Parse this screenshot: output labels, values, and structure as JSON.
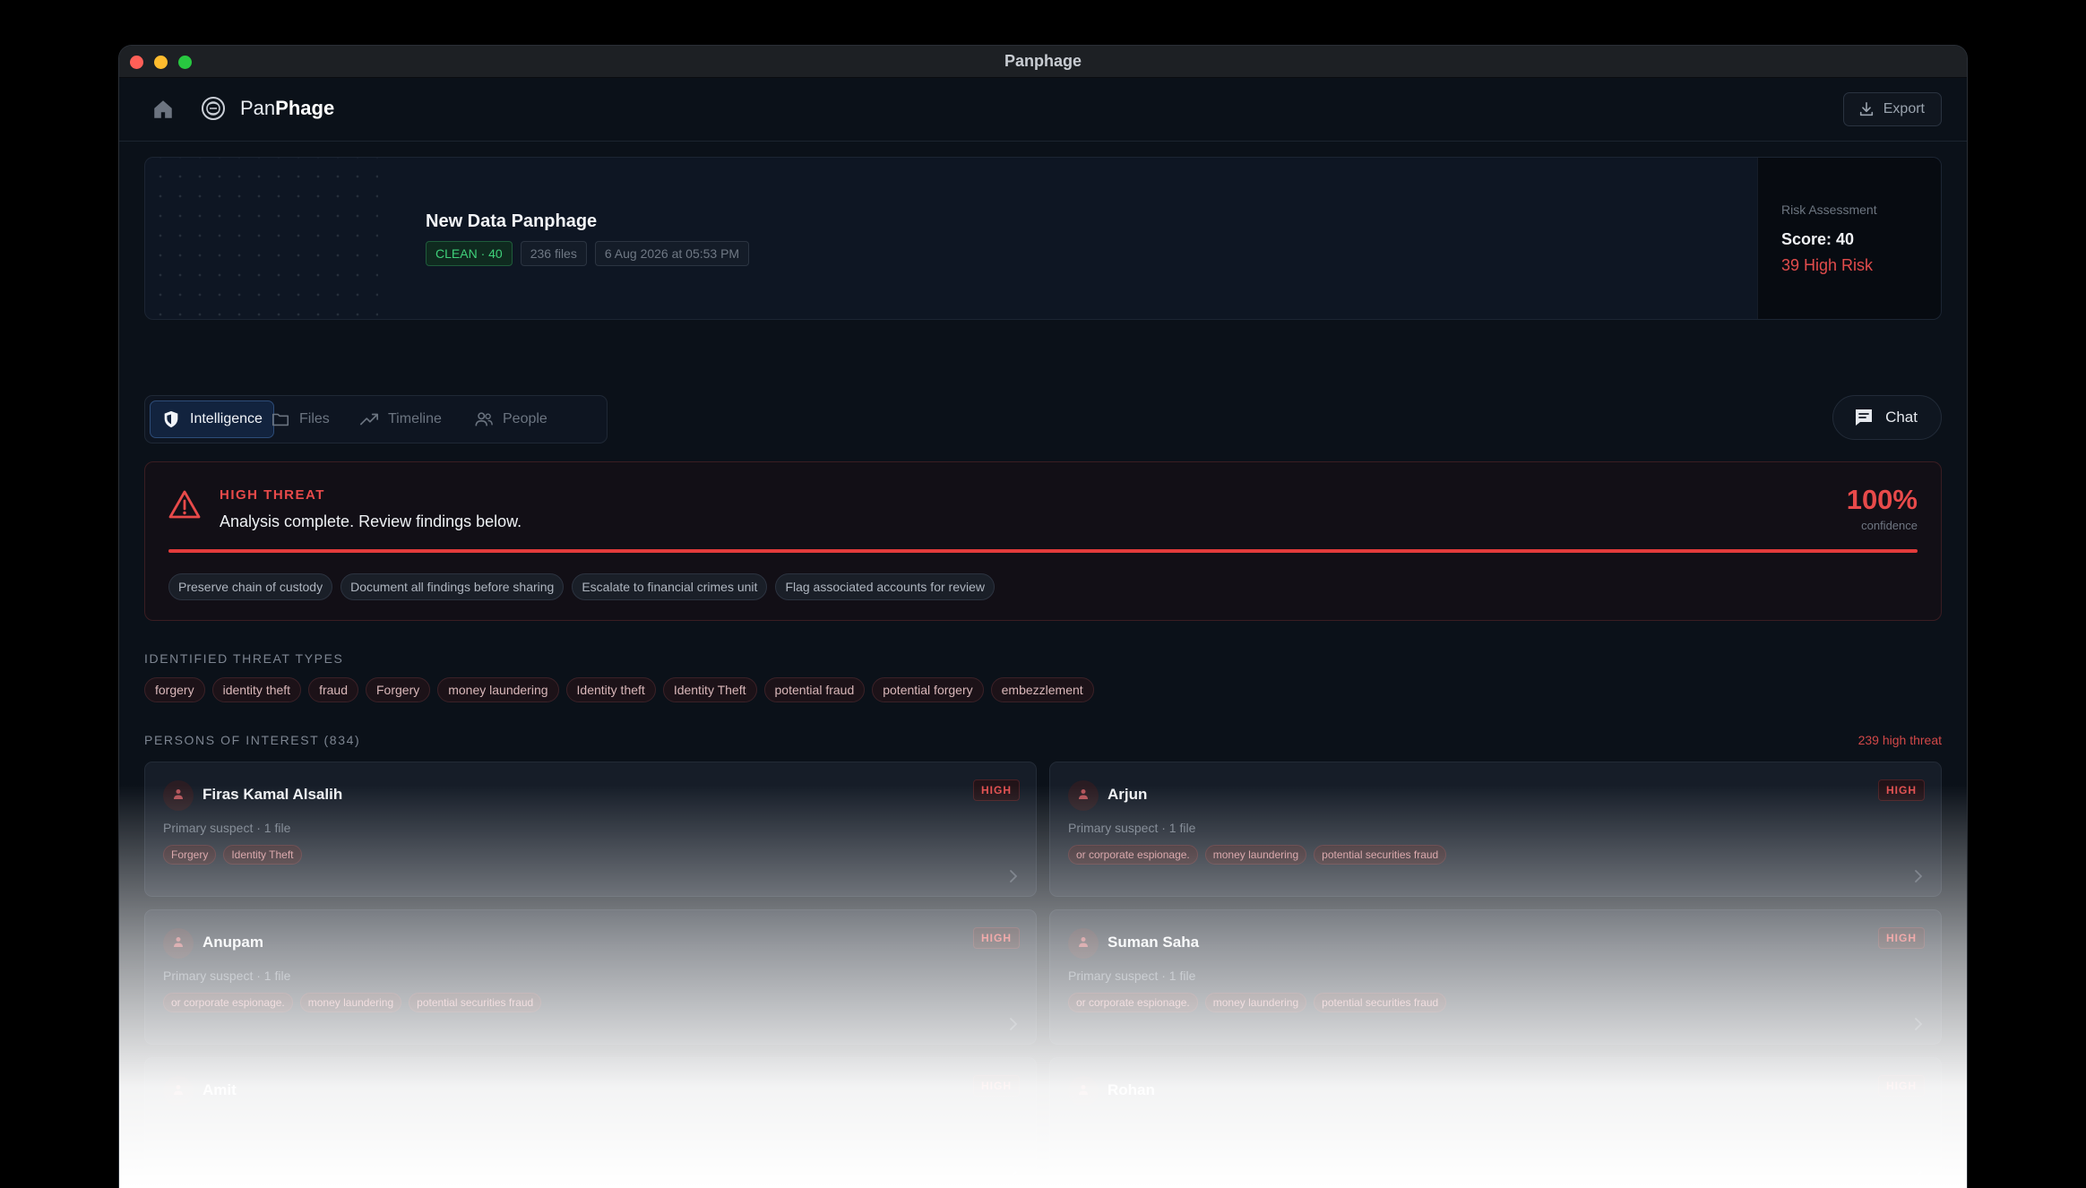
{
  "window": {
    "title": "Panphage"
  },
  "app": {
    "brand_prefix": "Pan",
    "brand_suffix": "Phage",
    "export_label": "Export"
  },
  "case": {
    "title": "New Data Panphage",
    "status_badge": "CLEAN · 40",
    "files_badge": "236 files",
    "date_badge": "6 Aug 2026 at 05:53 PM"
  },
  "risk": {
    "label": "Risk Assessment",
    "score": "Score: 40",
    "high": "39 High Risk"
  },
  "tabs": [
    {
      "label": "Intelligence",
      "icon": "shield-icon",
      "active": true
    },
    {
      "label": "Files",
      "icon": "folder-icon",
      "active": false
    },
    {
      "label": "Timeline",
      "icon": "trend-icon",
      "active": false
    },
    {
      "label": "People",
      "icon": "people-icon",
      "active": false
    }
  ],
  "chat_label": "Chat",
  "threat": {
    "level": "HIGH THREAT",
    "message": "Analysis complete. Review findings below.",
    "confidence_value": "100%",
    "confidence_label": "confidence",
    "confidence_fraction": 1.0,
    "actions": [
      "Preserve chain of custody",
      "Document all findings before sharing",
      "Escalate to financial crimes unit",
      "Flag associated accounts for review"
    ]
  },
  "threat_types": {
    "heading": "IDENTIFIED THREAT TYPES",
    "items": [
      "forgery",
      "identity theft",
      "fraud",
      "Forgery",
      "money laundering",
      "Identity theft",
      "Identity Theft",
      "potential fraud",
      "potential forgery",
      "embezzlement"
    ]
  },
  "persons": {
    "heading": "PERSONS OF INTEREST (834)",
    "high_count": "239 high threat",
    "items": [
      {
        "name": "Firas Kamal Alsalih",
        "level": "HIGH",
        "meta": "Primary suspect · 1 file",
        "tags": [
          "Forgery",
          "Identity Theft"
        ]
      },
      {
        "name": "Arjun",
        "level": "HIGH",
        "meta": "Primary suspect · 1 file",
        "tags": [
          "or corporate espionage.",
          "money laundering",
          "potential securities fraud"
        ]
      },
      {
        "name": "Anupam",
        "level": "HIGH",
        "meta": "Primary suspect · 1 file",
        "tags": [
          "or corporate espionage.",
          "money laundering",
          "potential securities fraud"
        ]
      },
      {
        "name": "Suman Saha",
        "level": "HIGH",
        "meta": "Primary suspect · 1 file",
        "tags": [
          "or corporate espionage.",
          "money laundering",
          "potential securities fraud"
        ]
      },
      {
        "name": "Amit",
        "level": "HIGH",
        "meta": "",
        "tags": []
      },
      {
        "name": "Rohan",
        "level": "HIGH",
        "meta": "",
        "tags": []
      }
    ]
  },
  "colors": {
    "accent_red": "#e84a4a",
    "clean_green": "#3fd07a",
    "active_tab_blue": "#2d4c78"
  }
}
